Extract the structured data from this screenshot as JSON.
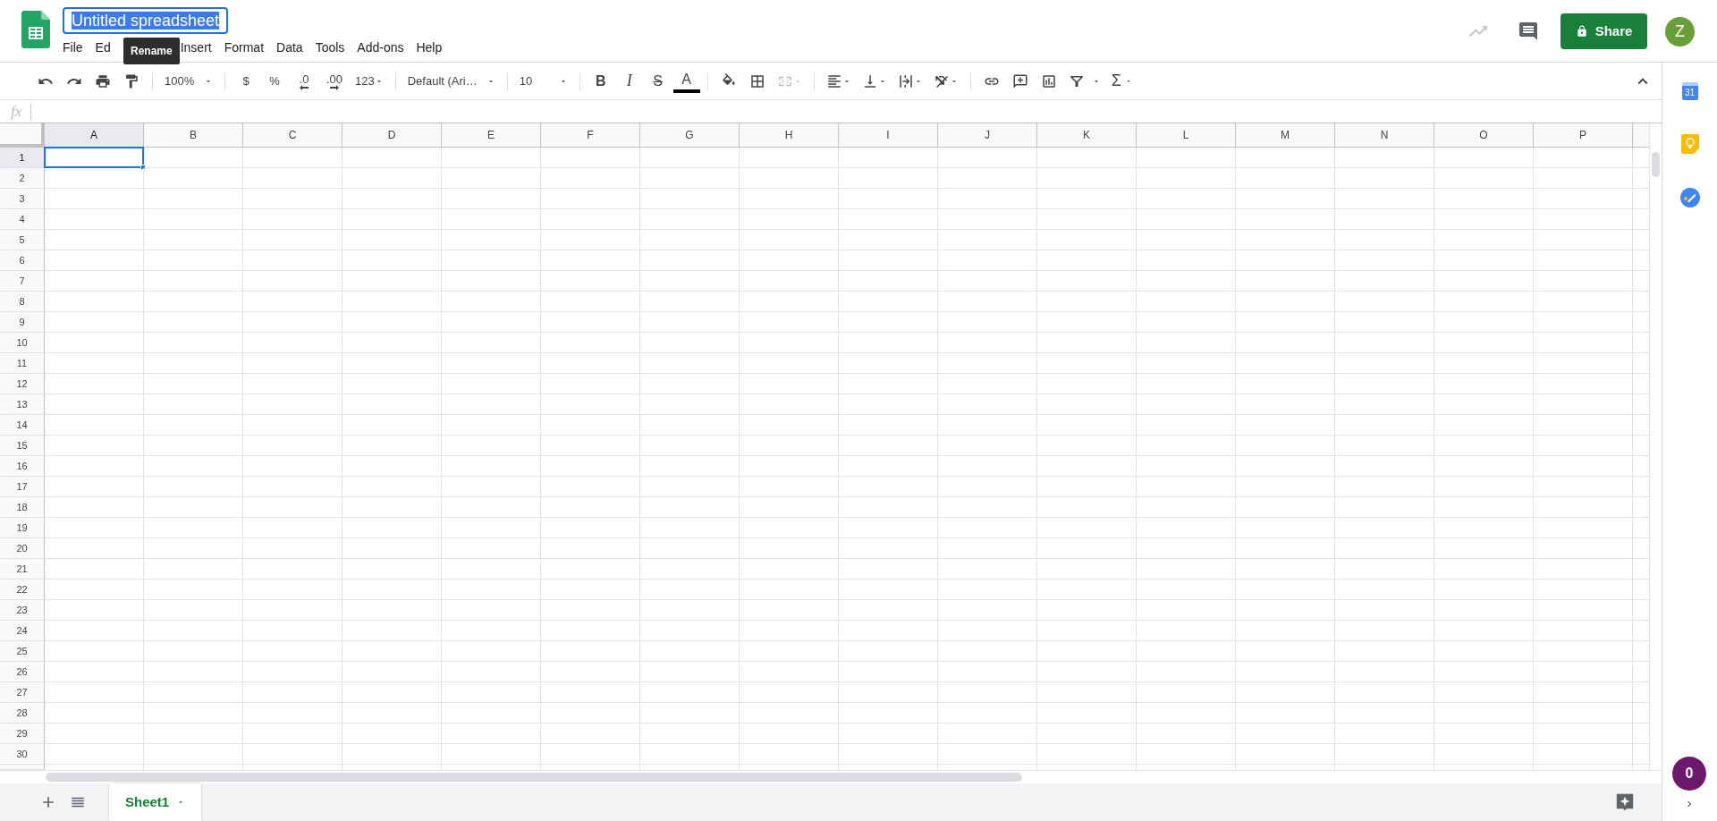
{
  "title": {
    "value": "Untitled spreadsheet",
    "text_selected": true,
    "tooltip": "Rename"
  },
  "menu": [
    {
      "label": "File",
      "covered": false
    },
    {
      "label": "Ed",
      "covered": true
    },
    {
      "label": "Insert",
      "covered": false
    },
    {
      "label": "Format",
      "covered": false
    },
    {
      "label": "Data",
      "covered": false
    },
    {
      "label": "Tools",
      "covered": false
    },
    {
      "label": "Add-ons",
      "covered": false
    },
    {
      "label": "Help",
      "covered": false
    }
  ],
  "share_button": {
    "label": "Share"
  },
  "avatar": {
    "initial": "Z"
  },
  "toolbar": {
    "zoom": "100%",
    "currency": "$",
    "percent": "%",
    "decrease_decimals": ".0",
    "increase_decimals": ".00",
    "number_format": "123",
    "font": "Default (Ari…",
    "font_size": "10",
    "bold": "B",
    "italic": "I",
    "strikethrough": "S",
    "text_color": "A",
    "merge_disabled": true,
    "functions": "Σ"
  },
  "formula_bar": {
    "label": "fx"
  },
  "columns": [
    {
      "label": "A",
      "selected": true
    },
    {
      "label": "B",
      "selected": false
    },
    {
      "label": "C",
      "selected": false
    },
    {
      "label": "D",
      "selected": false
    },
    {
      "label": "E",
      "selected": false
    },
    {
      "label": "F",
      "selected": false
    },
    {
      "label": "G",
      "selected": false
    },
    {
      "label": "H",
      "selected": false
    },
    {
      "label": "I",
      "selected": false
    },
    {
      "label": "J",
      "selected": false
    },
    {
      "label": "K",
      "selected": false
    },
    {
      "label": "L",
      "selected": false
    },
    {
      "label": "M",
      "selected": false
    },
    {
      "label": "N",
      "selected": false
    },
    {
      "label": "O",
      "selected": false
    },
    {
      "label": "P",
      "selected": false
    }
  ],
  "rows": [
    {
      "label": "1",
      "selected": true
    },
    {
      "label": "2",
      "selected": false
    },
    {
      "label": "3",
      "selected": false
    },
    {
      "label": "4",
      "selected": false
    },
    {
      "label": "5",
      "selected": false
    },
    {
      "label": "6",
      "selected": false
    },
    {
      "label": "7",
      "selected": false
    },
    {
      "label": "8",
      "selected": false
    },
    {
      "label": "9",
      "selected": false
    },
    {
      "label": "10",
      "selected": false
    },
    {
      "label": "11",
      "selected": false
    },
    {
      "label": "12",
      "selected": false
    },
    {
      "label": "13",
      "selected": false
    },
    {
      "label": "14",
      "selected": false
    },
    {
      "label": "15",
      "selected": false
    },
    {
      "label": "16",
      "selected": false
    },
    {
      "label": "17",
      "selected": false
    },
    {
      "label": "18",
      "selected": false
    },
    {
      "label": "19",
      "selected": false
    },
    {
      "label": "20",
      "selected": false
    },
    {
      "label": "21",
      "selected": false
    },
    {
      "label": "22",
      "selected": false
    },
    {
      "label": "23",
      "selected": false
    },
    {
      "label": "24",
      "selected": false
    },
    {
      "label": "25",
      "selected": false
    },
    {
      "label": "26",
      "selected": false
    },
    {
      "label": "27",
      "selected": false
    },
    {
      "label": "28",
      "selected": false
    },
    {
      "label": "29",
      "selected": false
    },
    {
      "label": "30",
      "selected": false
    }
  ],
  "sheet_tabs": [
    {
      "label": "Sheet1",
      "selected": true
    }
  ],
  "side_panel": {
    "calendar_date": "31"
  },
  "notification_badge": {
    "count": "0"
  }
}
